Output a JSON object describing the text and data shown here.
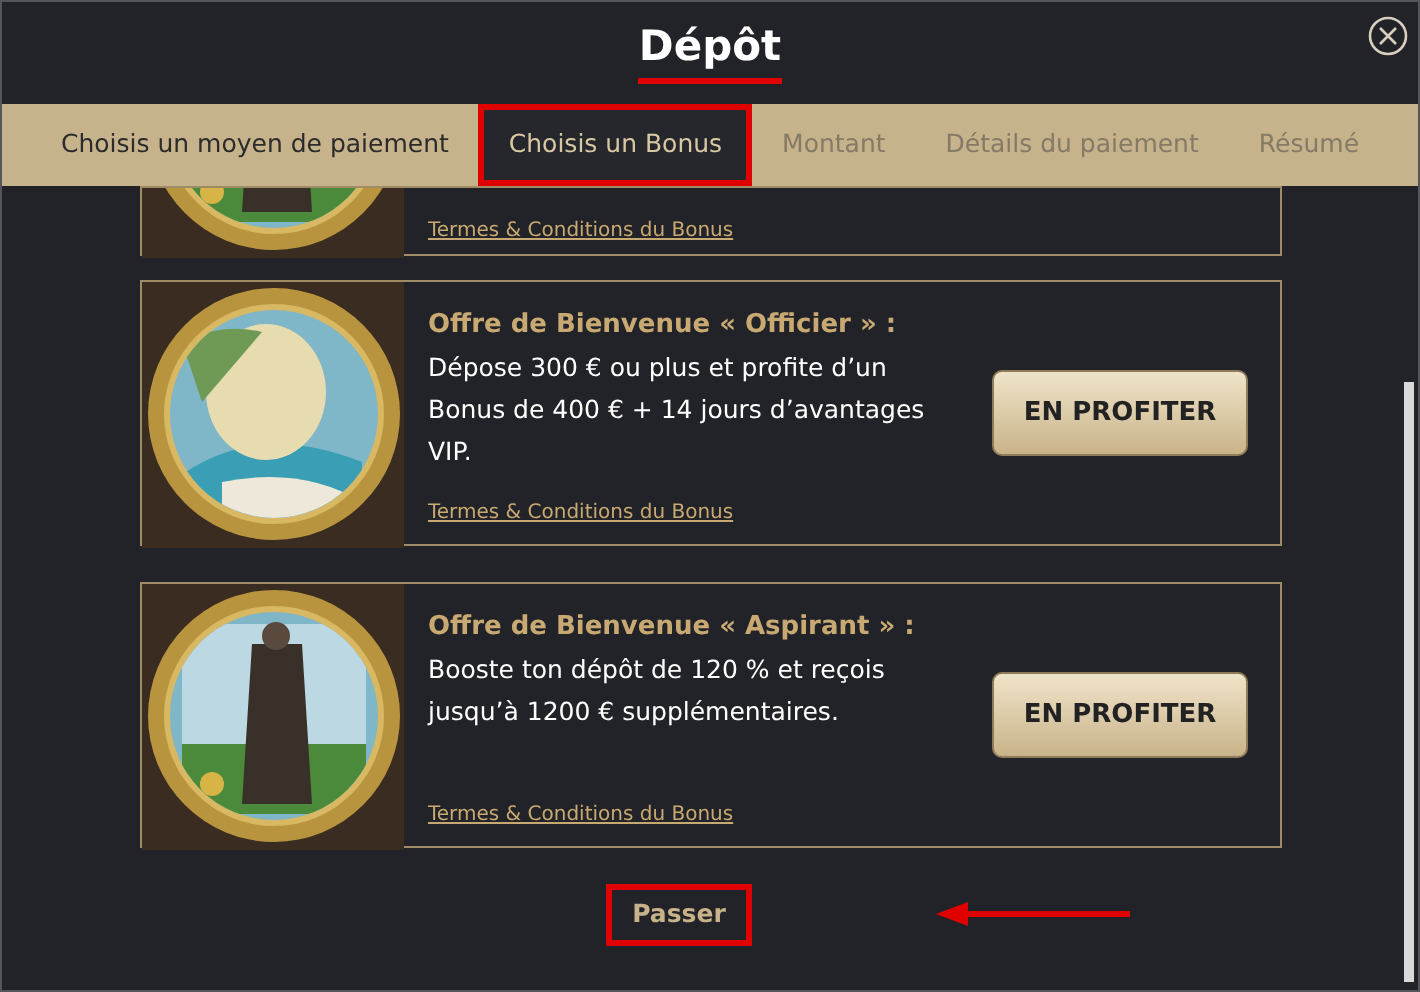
{
  "dialog": {
    "title": "Dépôt",
    "title_underlined": true
  },
  "steps": [
    {
      "label": "Choisis un moyen de paiement",
      "selected": false,
      "disabled": false,
      "highlighted": false
    },
    {
      "label": "Choisis un Bonus",
      "selected": true,
      "disabled": false,
      "highlighted": true
    },
    {
      "label": "Montant",
      "selected": false,
      "disabled": true,
      "highlighted": false
    },
    {
      "label": "Détails du paiement",
      "selected": false,
      "disabled": true,
      "highlighted": false
    },
    {
      "label": "Résumé",
      "selected": false,
      "disabled": true,
      "highlighted": false
    }
  ],
  "offers": [
    {
      "kind": "partial",
      "terms_link": "Termes & Conditions du Bonus"
    },
    {
      "kind": "full",
      "title": "Offre de Bienvenue « Officier » :",
      "description": "Dépose 300 € ou plus et profite d’un Bonus de 400 € + 14 jours d’avantages VIP.",
      "button": "EN PROFITER",
      "terms_link": "Termes & Conditions du Bonus"
    },
    {
      "kind": "full",
      "title": "Offre de Bienvenue « Aspirant » :",
      "description": "Booste ton dépôt de 120 % et reçois jusqu’à 1200 € supplémentaires.",
      "button": "EN PROFITER",
      "terms_link": "Termes & Conditions du Bonus"
    }
  ],
  "skip": {
    "label": "Passer",
    "highlighted": true,
    "arrow": true
  }
}
